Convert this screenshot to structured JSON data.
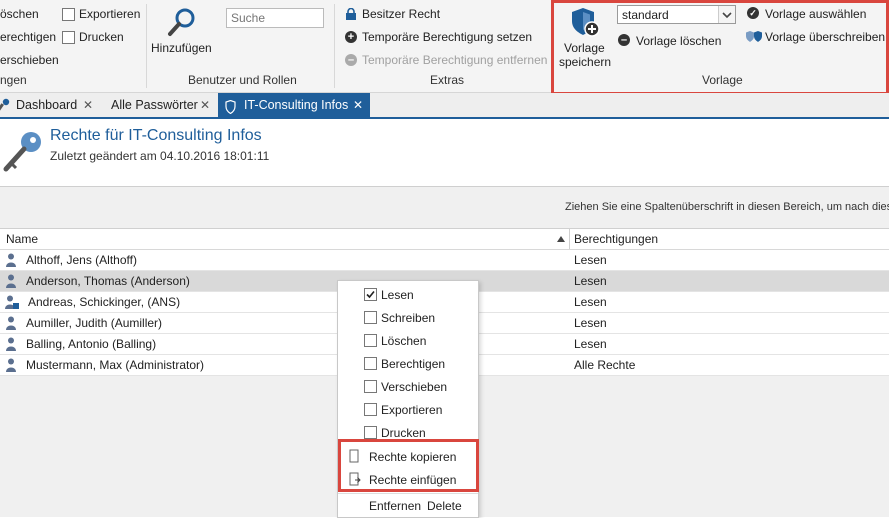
{
  "ribbon": {
    "col0": [
      "öschen",
      "erechtigen",
      "erschieben"
    ],
    "col0_group": "ngen",
    "checkboxes": [
      {
        "label": "Exportieren",
        "checked": false
      },
      {
        "label": "Drucken",
        "checked": false
      }
    ],
    "add_button": "Hinzufügen",
    "search_placeholder": "Suche",
    "users_group": "Benutzer und Rollen",
    "extras": {
      "owner": "Besitzer Recht",
      "temp_set": "Temporäre Berechtigung setzen",
      "temp_remove": "Temporäre Berechtigung entfernen",
      "group": "Extras"
    },
    "template": {
      "save_line1": "Vorlage",
      "save_line2": "speichern",
      "select_value": "standard",
      "delete": "Vorlage löschen",
      "choose": "Vorlage auswählen",
      "overwrite": "Vorlage überschreiben",
      "group": "Vorlage"
    }
  },
  "tabs": [
    {
      "label": "Dashboard",
      "active": false
    },
    {
      "label": "Alle Passwörter",
      "active": false
    },
    {
      "label": "IT-Consulting Infos",
      "active": true
    }
  ],
  "header": {
    "title": "Rechte für IT-Consulting Infos",
    "subtitle": "Zuletzt geändert am 04.10.2016 18:01:11"
  },
  "grid": {
    "group_hint": "Ziehen Sie eine Spaltenüberschrift in diesen Bereich, um nach diese",
    "col_name": "Name",
    "col_perm": "Berechtigungen",
    "rows": [
      {
        "name": "Althoff, Jens (Althoff)",
        "perm": "Lesen",
        "icon": "user-icon"
      },
      {
        "name": "Anderson, Thomas (Anderson)",
        "perm": "Lesen",
        "icon": "user-icon"
      },
      {
        "name": "Andreas, Schickinger, (ANS)",
        "perm": "Lesen",
        "icon": "user-group-icon"
      },
      {
        "name": "Aumiller, Judith (Aumiller)",
        "perm": "Lesen",
        "icon": "user-icon"
      },
      {
        "name": "Balling, Antonio (Balling)",
        "perm": "Lesen",
        "icon": "user-icon"
      },
      {
        "name": "Mustermann, Max (Administrator)",
        "perm": "Alle Rechte",
        "icon": "user-icon"
      }
    ]
  },
  "context_menu": {
    "items": [
      {
        "label": "Lesen",
        "checked": true
      },
      {
        "label": "Schreiben",
        "checked": false
      },
      {
        "label": "Löschen",
        "checked": false
      },
      {
        "label": "Berechtigen",
        "checked": false
      },
      {
        "label": "Verschieben",
        "checked": false
      },
      {
        "label": "Exportieren",
        "checked": false
      },
      {
        "label": "Drucken",
        "checked": false
      }
    ],
    "copy": "Rechte kopieren",
    "paste": "Rechte einfügen",
    "remove": "Entfernen",
    "remove_shortcut": "Delete"
  },
  "colors": {
    "accent": "#1f5e9a",
    "highlight": "#d9463e",
    "selected_row": "#d9d9d9"
  }
}
